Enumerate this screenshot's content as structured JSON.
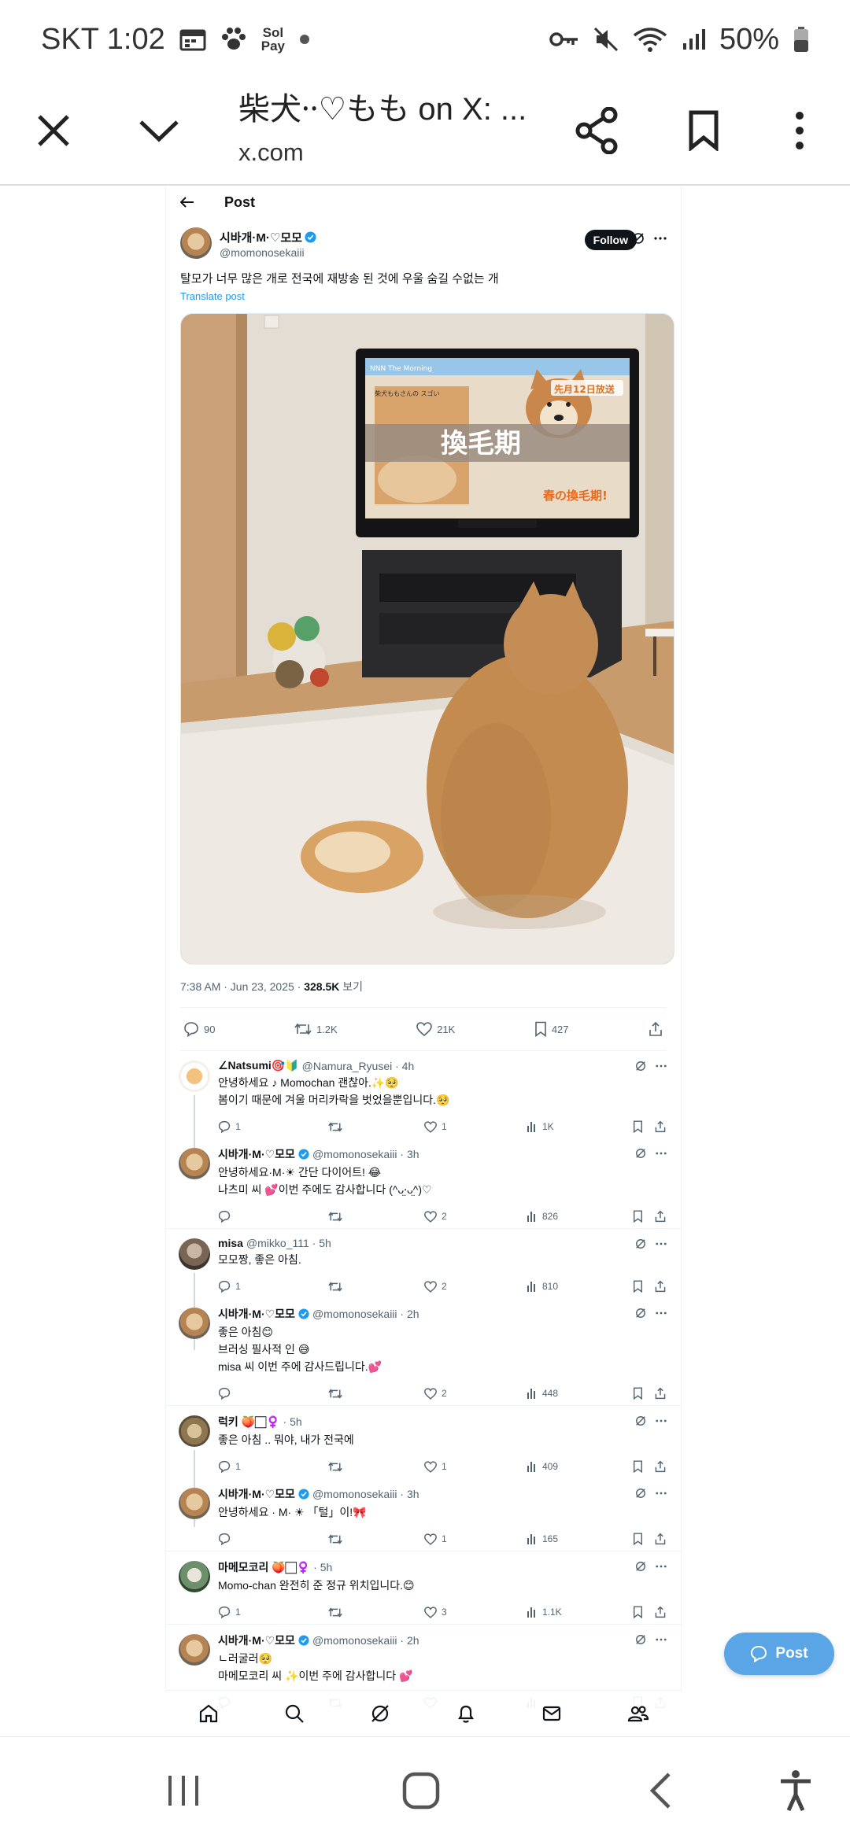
{
  "status_bar": {
    "carrier_time": "SKT 1:02",
    "sol_pay_line1": "Sol",
    "sol_pay_line2": "Pay",
    "battery": "50%"
  },
  "tab_bar": {
    "title": "柴犬⸱⸱♡もも on X: ...",
    "url": "x.com"
  },
  "post_view": {
    "header": "Post",
    "author_name": "시바개·M·♡모모",
    "author_handle": "@momonosekaiii",
    "follow_label": "Follow",
    "text": "탈모가 너무 많은 개로 전국에 재방송 된 것에 우울 숨길 수없는 개",
    "translate": "Translate post",
    "photo": {
      "tv_tag": "NNN The Morning",
      "tv_sub": "柴犬ももさんの\nスゴい",
      "tv_date": "先月12日放送",
      "tv_headline": "換毛期",
      "tv_caption": "春の換毛期!"
    },
    "timestamp": "7:38 AM · Jun 23, 2025 · ",
    "views": "328.5K",
    "views_label": " 보기",
    "stats": {
      "replies": "90",
      "reposts": "1.2K",
      "likes": "21K",
      "bookmarks": "427"
    }
  },
  "replies": [
    {
      "name": "∠Natsumi🎯🔰",
      "handle": "@Namura_Ryusei · 4h",
      "lines": [
        "안녕하세요 ♪ Momochan 괜찮아.✨🥺",
        "봄이기 때문에 겨울 머리카락을 벗었을뿐입니다.🥺"
      ],
      "replies": "1",
      "reposts": "",
      "likes": "1",
      "views": "1K"
    },
    {
      "name": "시바개·M·♡모모",
      "handle": "@momonosekaiii · 3h",
      "lines": [
        "안녕하세요·M·☀ 간단 다이어트! 😂",
        "나츠미 씨 💕이번 주에도 감사합니다 (^ᴗ̤⸱ᴗ̤^)♡"
      ],
      "replies": "",
      "reposts": "",
      "likes": "2",
      "views": "826"
    },
    {
      "name": "misa",
      "handle": "@mikko_111 · 5h",
      "lines": [
        "모모짱, 좋은 아침."
      ],
      "replies": "1",
      "reposts": "",
      "likes": "2",
      "views": "810"
    },
    {
      "name": "시바개·M·♡모모",
      "handle": "@momonosekaiii · 2h",
      "lines": [
        "좋은 아침😊",
        "브러싱 필사적 인 😅",
        "misa 씨 이번 주에 감사드립니다.💕"
      ],
      "replies": "",
      "reposts": "",
      "likes": "2",
      "views": "448"
    },
    {
      "name": "럭키 🍑🏻♀️",
      "handle": "· 5h",
      "lines": [
        "좋은 아침 .. 뭐야, 내가 전국에"
      ],
      "replies": "1",
      "reposts": "",
      "likes": "1",
      "views": "409"
    },
    {
      "name": "시바개·M·♡모모",
      "handle": "@momonosekaiii · 3h",
      "lines": [
        "안녕하세요 · M· ☀ 「털」이!🎀"
      ],
      "replies": "",
      "reposts": "",
      "likes": "1",
      "views": "165"
    },
    {
      "name": "마메모코리 🍑🏻♀️",
      "handle": "· 5h",
      "lines": [
        "Momo-chan 완전히 준 정규 위치입니다.😊"
      ],
      "replies": "1",
      "reposts": "",
      "likes": "3",
      "views": "1.1K"
    },
    {
      "name": "시바개·M·♡모모",
      "handle": "@momonosekaiii · 2h",
      "lines": [
        "ㄴ러굴러🥺",
        "마메모코리 씨 ✨이번 주에 감사합니다 💕"
      ],
      "replies": "",
      "reposts": "",
      "likes": "",
      "views": ""
    }
  ],
  "float_button": "Post"
}
